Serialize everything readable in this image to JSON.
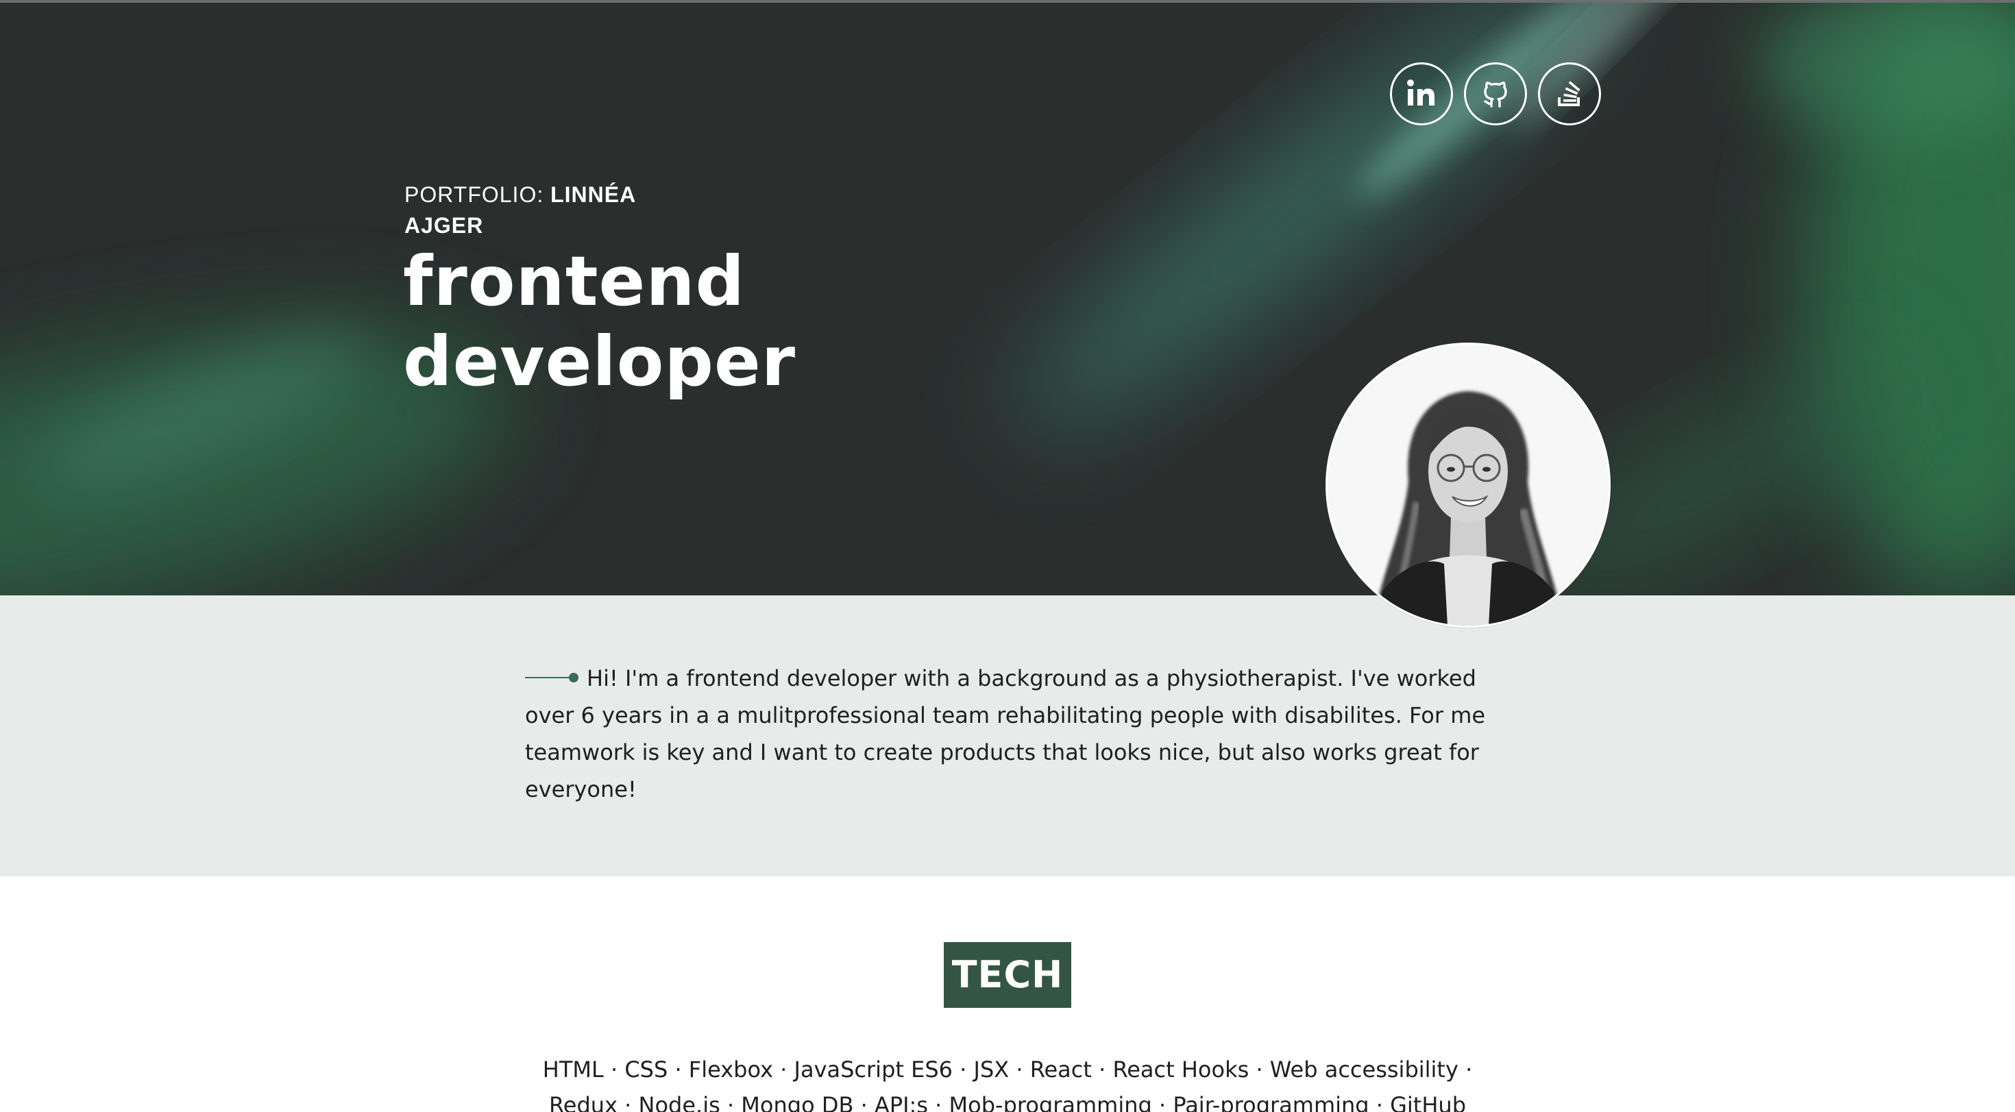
{
  "header": {
    "portfolio_prefix": "PORTFOLIO: ",
    "portfolio_name": "LINNÉA AJGER",
    "title_line1": "frontend",
    "title_line2": "developer"
  },
  "social": [
    {
      "name": "linkedin",
      "icon": "linkedin-icon"
    },
    {
      "name": "github",
      "icon": "github-icon"
    },
    {
      "name": "stackoverflow",
      "icon": "stackoverflow-icon"
    }
  ],
  "intro": {
    "text": "Hi! I'm a frontend developer with a background as a physiotherapist. I've worked over 6 years in a a mulitprofessional team rehabilitating people with disabilites. For me teamwork is key and I want to create products that looks nice, but also works great for everyone!"
  },
  "tech": {
    "heading": "TECH",
    "items": [
      "HTML",
      "CSS",
      "Flexbox",
      "JavaScript ES6",
      "JSX",
      "React",
      "React Hooks",
      "Web accessibility",
      "Redux",
      "Node.js",
      "Mongo DB",
      "API:s",
      "Mob-programming",
      "Pair-programming",
      "GitHub"
    ],
    "separator": "·"
  },
  "colors": {
    "hero_dark": "#2b302f",
    "hero_green": "#3f8a64",
    "intro_bg": "#e7eceb",
    "accent": "#345543",
    "text": "#1f1f1f"
  }
}
